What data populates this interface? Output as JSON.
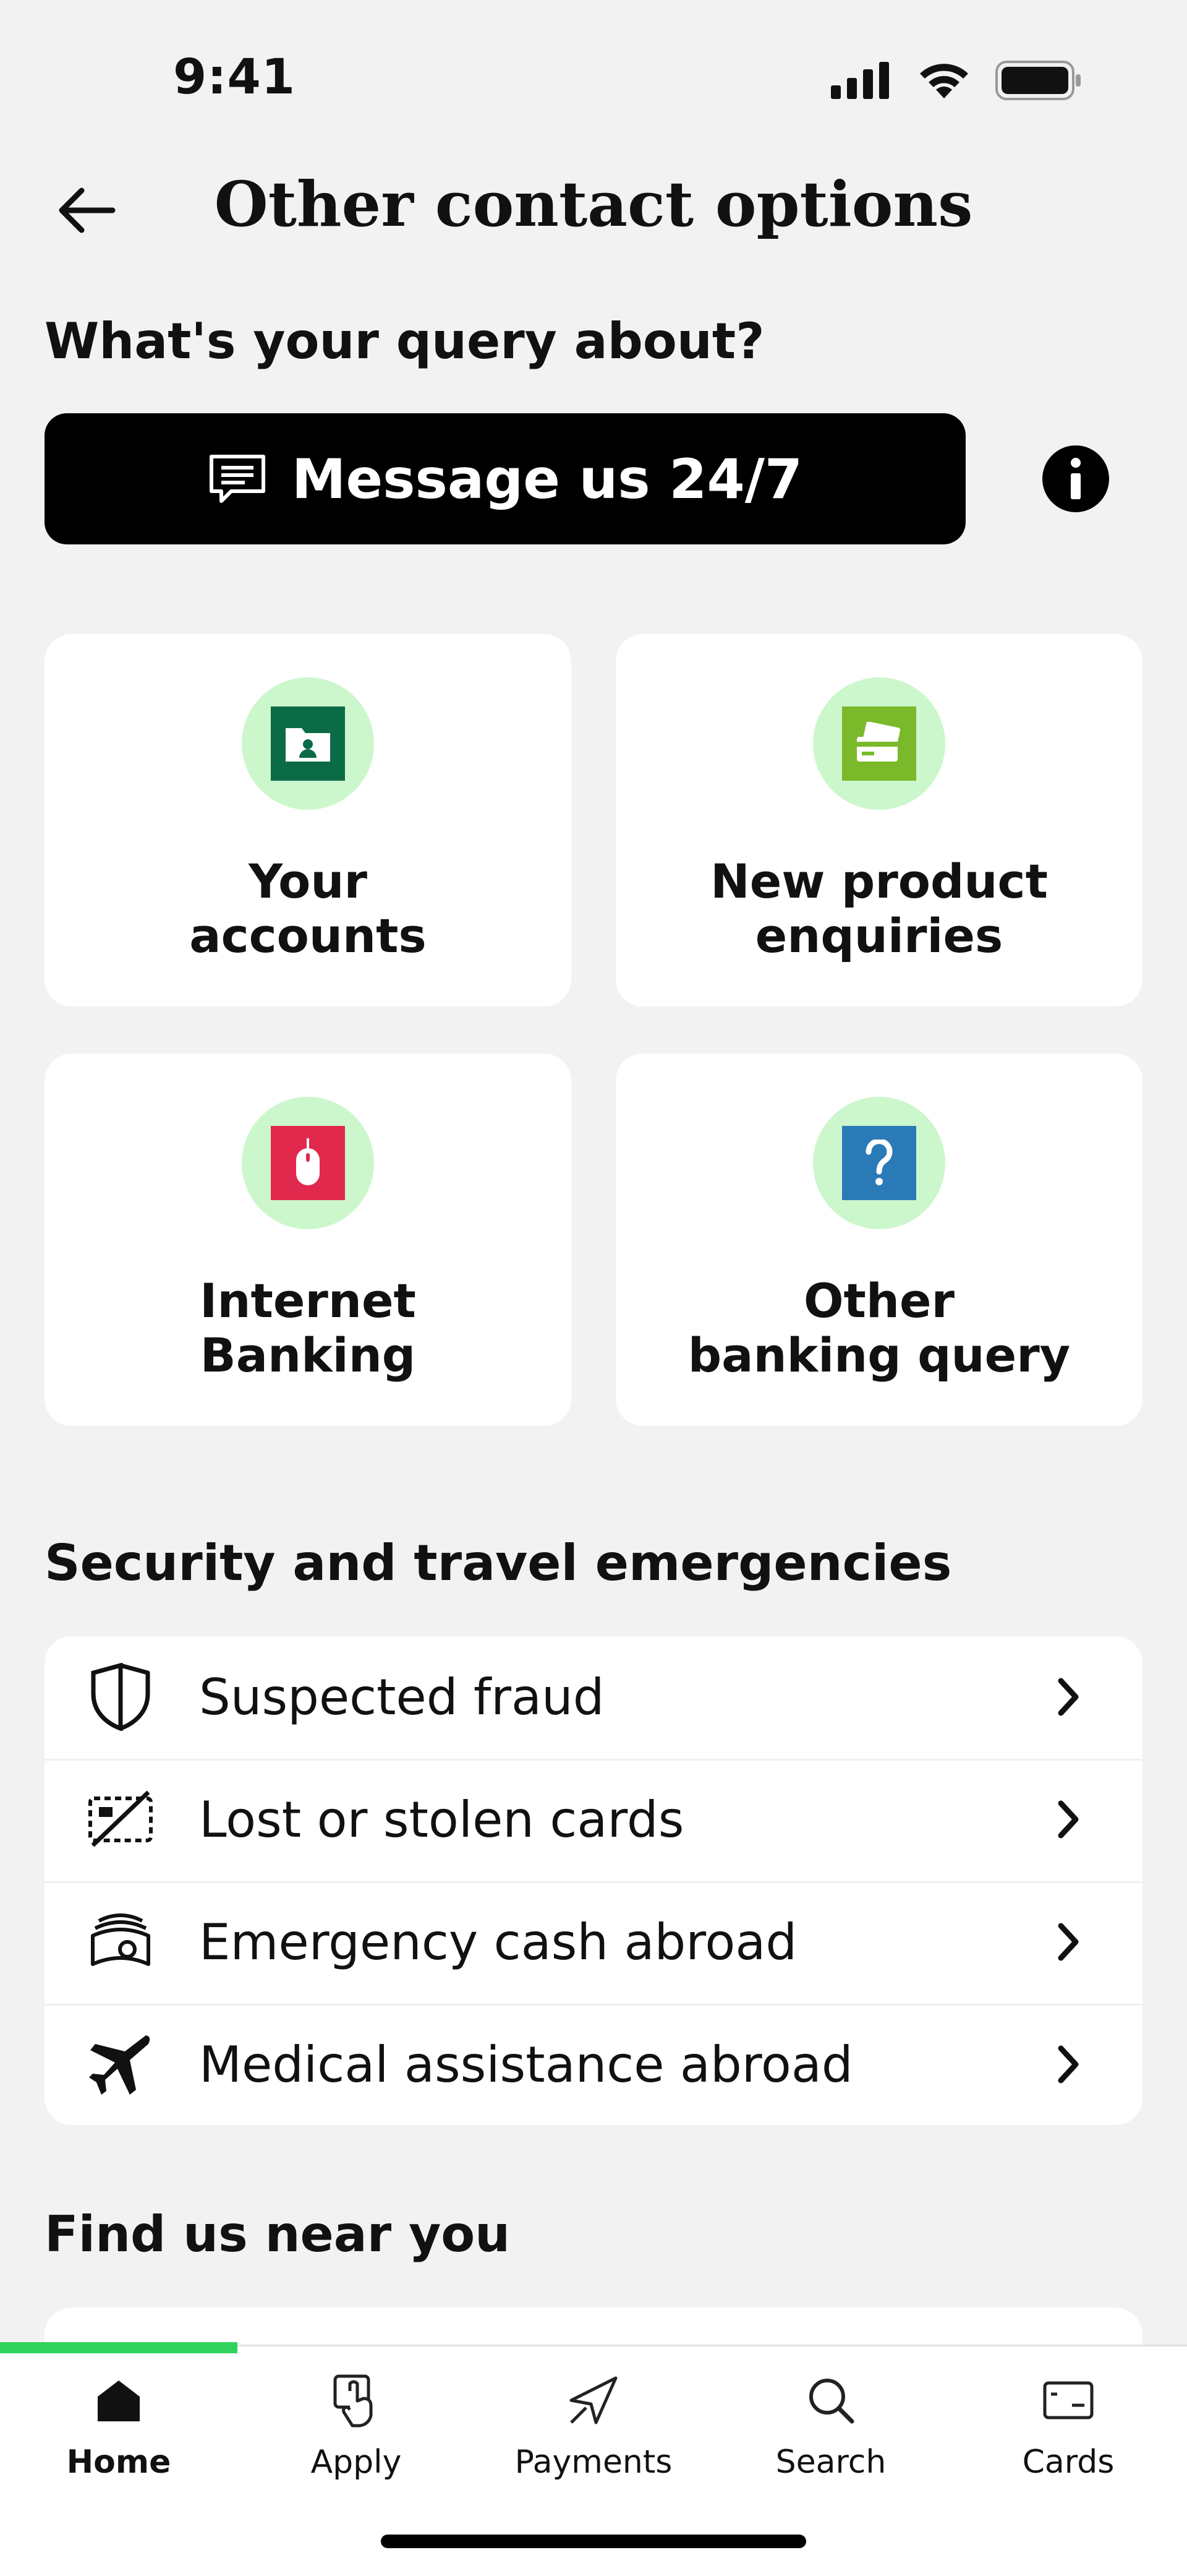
{
  "status_bar": {
    "time": "9:41"
  },
  "header": {
    "title": "Other contact options"
  },
  "query": {
    "heading": "What's your query about?",
    "message_label": "Message us 24/7"
  },
  "cards": [
    {
      "line1": "Your",
      "line2": "accounts",
      "icon": "folder-user-icon",
      "color": "#0b6b47"
    },
    {
      "line1": "New product",
      "line2": "enquiries",
      "icon": "cards-icon",
      "color": "#7ab929"
    },
    {
      "line1": "Internet",
      "line2": "Banking",
      "icon": "mouse-icon",
      "color": "#e0294d"
    },
    {
      "line1": "Other",
      "line2": "banking query",
      "icon": "question-icon",
      "color": "#2a7ab8"
    }
  ],
  "security": {
    "heading": "Security and travel emergencies",
    "items": [
      {
        "label": "Suspected fraud",
        "icon": "shield-icon"
      },
      {
        "label": "Lost or stolen cards",
        "icon": "card-crossed-icon"
      },
      {
        "label": "Emergency cash abroad",
        "icon": "cash-icon"
      },
      {
        "label": "Medical assistance abroad",
        "icon": "plane-icon"
      }
    ]
  },
  "find": {
    "heading": "Find us near you"
  },
  "tabs": [
    {
      "label": "Home",
      "icon": "home-icon",
      "active": true
    },
    {
      "label": "Apply",
      "icon": "apply-icon"
    },
    {
      "label": "Payments",
      "icon": "payments-icon"
    },
    {
      "label": "Search",
      "icon": "search-icon"
    },
    {
      "label": "Cards",
      "icon": "card-icon"
    }
  ],
  "colors": {
    "accent_green": "#2fd35b",
    "icon_circle": "#ccf7cc"
  }
}
